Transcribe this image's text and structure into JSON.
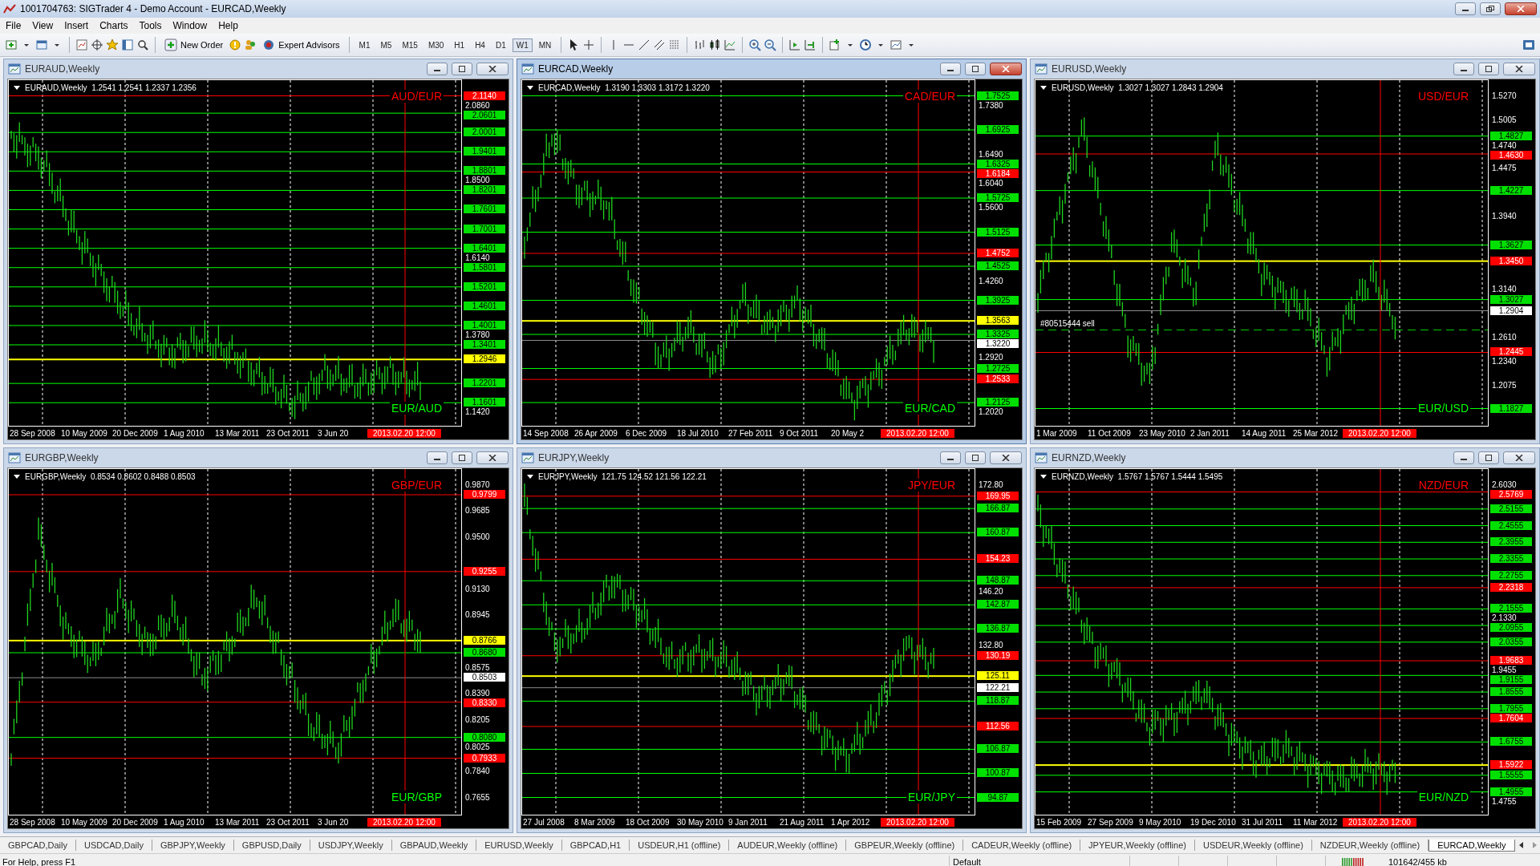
{
  "window": {
    "title": "1001704763: SIGTrader 4 - Demo Account - EURCAD,Weekly"
  },
  "menu": [
    "File",
    "View",
    "Insert",
    "Charts",
    "Tools",
    "Window",
    "Help"
  ],
  "toolbar": {
    "buttons": [
      {
        "label": "New Order"
      },
      {
        "label": "Expert Advisors"
      }
    ],
    "timeframes": [
      {
        "label": "M1",
        "selected": false
      },
      {
        "label": "M5",
        "selected": false
      },
      {
        "label": "M15",
        "selected": false
      },
      {
        "label": "M30",
        "selected": false
      },
      {
        "label": "H1",
        "selected": false
      },
      {
        "label": "H4",
        "selected": false
      },
      {
        "label": "D1",
        "selected": false
      },
      {
        "label": "W1",
        "selected": true
      },
      {
        "label": "MN",
        "selected": false
      }
    ]
  },
  "charts": [
    {
      "window_title": "EURAUD,Weekly",
      "active": false,
      "header": "EURAUD,Weekly  1.2541 1.2541 1.2337 1.2356",
      "top_label": "AUD/EUR",
      "bottom_label": "EUR/AUD",
      "axis_labels": [
        "2.0860",
        "1.8500",
        "1.6140",
        "1.3780",
        "1.1420"
      ],
      "levels": [
        {
          "price": "2.1140",
          "kind": "resistance"
        },
        {
          "price": "2.0601",
          "kind": "support"
        },
        {
          "price": "2.0001",
          "kind": "support"
        },
        {
          "price": "1.9401",
          "kind": "support"
        },
        {
          "price": "1.8801",
          "kind": "support"
        },
        {
          "price": "1.8201",
          "kind": "support"
        },
        {
          "price": "1.7601",
          "kind": "support"
        },
        {
          "price": "1.7001",
          "kind": "support"
        },
        {
          "price": "1.6401",
          "kind": "support"
        },
        {
          "price": "1.5801",
          "kind": "support"
        },
        {
          "price": "1.5201",
          "kind": "support"
        },
        {
          "price": "1.4601",
          "kind": "support"
        },
        {
          "price": "1.4001",
          "kind": "support"
        },
        {
          "price": "1.3401",
          "kind": "support"
        },
        {
          "price": "1.2946",
          "kind": "pivot"
        },
        {
          "price": "1.2201",
          "kind": "support"
        },
        {
          "price": "1.1601",
          "kind": "support"
        }
      ],
      "dates": [
        "28 Sep 2008",
        "10 May 2009",
        "20 Dec 2009",
        "1 Aug 2010",
        "13 Mar 2011",
        "23 Oct 2011",
        "3 Jun 20"
      ],
      "cursor_date": "2013.02.20 12:00"
    },
    {
      "window_title": "EURCAD,Weekly",
      "active": true,
      "header": "EURCAD,Weekly  1.3190 1.3303 1.3172 1.3220",
      "top_label": "CAD/EUR",
      "bottom_label": "EUR/CAD",
      "axis_labels": [
        "1.7380",
        "1.6490",
        "1.6040",
        "1.5600",
        "1.4260",
        "1.2920",
        "1.2020"
      ],
      "levels": [
        {
          "price": "1.7525",
          "kind": "support"
        },
        {
          "price": "1.6925",
          "kind": "support"
        },
        {
          "price": "1.6325",
          "kind": "support"
        },
        {
          "price": "1.6184",
          "kind": "resistance"
        },
        {
          "price": "1.5725",
          "kind": "support"
        },
        {
          "price": "1.5125",
          "kind": "support"
        },
        {
          "price": "1.4752",
          "kind": "resistance"
        },
        {
          "price": "1.4525",
          "kind": "support"
        },
        {
          "price": "1.3925",
          "kind": "support"
        },
        {
          "price": "1.3563",
          "kind": "pivot"
        },
        {
          "price": "1.3325",
          "kind": "support"
        },
        {
          "price": "1.3220",
          "kind": "bid"
        },
        {
          "price": "1.2725",
          "kind": "support"
        },
        {
          "price": "1.2533",
          "kind": "resistance"
        },
        {
          "price": "1.2125",
          "kind": "support"
        }
      ],
      "dates": [
        "14 Sep 2008",
        "26 Apr 2009",
        "6 Dec 2009",
        "18 Jul 2010",
        "27 Feb 2011",
        "9 Oct 2011",
        "20 May 2"
      ],
      "cursor_date": "2013.02.20 12:00"
    },
    {
      "window_title": "EURUSD,Weekly",
      "active": false,
      "header": "EURUSD,Weekly  1.3027 1.3027 1.2843 1.2904",
      "top_label": "USD/EUR",
      "bottom_label": "EUR/USD",
      "axis_labels": [
        "1.5270",
        "1.5005",
        "1.4740",
        "1.4475",
        "1.3940",
        "1.3140",
        "1.2610",
        "1.2340",
        "1.2075"
      ],
      "levels": [
        {
          "price": "1.4827",
          "kind": "support"
        },
        {
          "price": "1.4630",
          "kind": "resistance"
        },
        {
          "price": "1.4227",
          "kind": "support"
        },
        {
          "price": "1.3627",
          "kind": "support"
        },
        {
          "price": "1.3450",
          "kind": "alert"
        },
        {
          "price": "1.3027",
          "kind": "support"
        },
        {
          "price": "1.2904",
          "kind": "bid"
        },
        {
          "price": "1.2445",
          "kind": "resistance"
        },
        {
          "price": "1.1827",
          "kind": "support"
        }
      ],
      "order_line": {
        "label": "#80515444 sell"
      },
      "dates": [
        "1 Mar 2009",
        "11 Oct 2009",
        "23 May 2010",
        "2 Jan 2011",
        "14 Aug 2011",
        "25 Mar 2012"
      ],
      "cursor_date": "2013.02.20 12:00"
    },
    {
      "window_title": "EURGBP,Weekly",
      "active": false,
      "header": "EURGBP,Weekly  0.8534 0.8602 0.8488 0.8503",
      "top_label": "GBP/EUR",
      "bottom_label": "EUR/GBP",
      "axis_labels": [
        "0.9870",
        "0.9685",
        "0.9500",
        "0.9130",
        "0.8945",
        "0.8575",
        "0.8390",
        "0.8205",
        "0.8025",
        "0.7840",
        "0.7655"
      ],
      "levels": [
        {
          "price": "0.9799",
          "kind": "resistance"
        },
        {
          "price": "0.9255",
          "kind": "resistance"
        },
        {
          "price": "0.8766",
          "kind": "pivot"
        },
        {
          "price": "0.8680",
          "kind": "support"
        },
        {
          "price": "0.8503",
          "kind": "bid"
        },
        {
          "price": "0.8330",
          "kind": "resistance"
        },
        {
          "price": "0.8080",
          "kind": "support"
        },
        {
          "price": "0.7933",
          "kind": "resistance"
        }
      ],
      "dates": [
        "28 Sep 2008",
        "10 May 2009",
        "20 Dec 2009",
        "1 Aug 2010",
        "13 Mar 2011",
        "23 Oct 2011",
        "3 Jun 20"
      ],
      "cursor_date": "2013.02.20 12:00"
    },
    {
      "window_title": "EURJPY,Weekly",
      "active": false,
      "header": "EURJPY,Weekly  121.75 124.52 121.56 122.21",
      "top_label": "JPY/EUR",
      "bottom_label": "EUR/JPY",
      "axis_labels": [
        "172.80",
        "146.20",
        "132.80"
      ],
      "levels": [
        {
          "price": "169.95",
          "kind": "resistance"
        },
        {
          "price": "166.87",
          "kind": "support"
        },
        {
          "price": "160.87",
          "kind": "support"
        },
        {
          "price": "154.23",
          "kind": "resistance"
        },
        {
          "price": "148.87",
          "kind": "support"
        },
        {
          "price": "142.87",
          "kind": "support"
        },
        {
          "price": "136.87",
          "kind": "support"
        },
        {
          "price": "130.19",
          "kind": "resistance"
        },
        {
          "price": "125.11",
          "kind": "pivot"
        },
        {
          "price": "122.21",
          "kind": "bid"
        },
        {
          "price": "118.87",
          "kind": "support"
        },
        {
          "price": "112.56",
          "kind": "resistance"
        },
        {
          "price": "106.87",
          "kind": "support"
        },
        {
          "price": "100.87",
          "kind": "support"
        },
        {
          "price": "94.87",
          "kind": "support"
        }
      ],
      "dates": [
        "27 Jul 2008",
        "8 Mar 2009",
        "18 Oct 2009",
        "30 May 2010",
        "9 Jan 2011",
        "21 Aug 2011",
        "1 Apr 2012"
      ],
      "cursor_date": "2013.02.20 12:00"
    },
    {
      "window_title": "EURNZD,Weekly",
      "active": false,
      "header": "EURNZD,Weekly  1.5767 1.5767 1.5444 1.5495",
      "top_label": "NZD/EUR",
      "bottom_label": "EUR/NZD",
      "axis_labels": [
        "2.6030",
        "2.1330",
        "1.9455",
        "1.4755"
      ],
      "levels": [
        {
          "price": "2.5769",
          "kind": "resistance"
        },
        {
          "price": "2.5155",
          "kind": "support"
        },
        {
          "price": "2.4555",
          "kind": "support"
        },
        {
          "price": "2.3955",
          "kind": "support"
        },
        {
          "price": "2.3355",
          "kind": "support"
        },
        {
          "price": "2.2755",
          "kind": "support"
        },
        {
          "price": "2.2318",
          "kind": "resistance"
        },
        {
          "price": "2.1555",
          "kind": "support"
        },
        {
          "price": "2.0955",
          "kind": "support"
        },
        {
          "price": "2.0355",
          "kind": "support"
        },
        {
          "price": "1.9683",
          "kind": "resistance"
        },
        {
          "price": "1.9155",
          "kind": "support"
        },
        {
          "price": "1.8555",
          "kind": "support"
        },
        {
          "price": "1.7955",
          "kind": "support"
        },
        {
          "price": "1.7604",
          "kind": "resistance"
        },
        {
          "price": "1.6755",
          "kind": "support"
        },
        {
          "price": "1.5922",
          "kind": "alert"
        },
        {
          "price": "1.5555",
          "kind": "support"
        },
        {
          "price": "1.4955",
          "kind": "support"
        }
      ],
      "dates": [
        "15 Feb 2009",
        "27 Sep 2009",
        "9 May 2010",
        "19 Dec 2010",
        "31 Jul 2011",
        "11 Mar 2012"
      ],
      "cursor_date": "2013.02.20 12:00"
    }
  ],
  "tabs": [
    {
      "label": "GBPCAD,Daily",
      "selected": false
    },
    {
      "label": "USDCAD,Daily",
      "selected": false
    },
    {
      "label": "GBPJPY,Weekly",
      "selected": false
    },
    {
      "label": "GBPUSD,Daily",
      "selected": false
    },
    {
      "label": "USDJPY,Weekly",
      "selected": false
    },
    {
      "label": "GBPAUD,Weekly",
      "selected": false
    },
    {
      "label": "EURUSD,Weekly",
      "selected": false
    },
    {
      "label": "GBPCAD,H1",
      "selected": false
    },
    {
      "label": "USDEUR,H1 (offline)",
      "selected": false
    },
    {
      "label": "AUDEUR,Weekly (offline)",
      "selected": false
    },
    {
      "label": "GBPEUR,Weekly (offline)",
      "selected": false
    },
    {
      "label": "CADEUR,Weekly (offline)",
      "selected": false
    },
    {
      "label": "JPYEUR,Weekly (offline)",
      "selected": false
    },
    {
      "label": "USDEUR,Weekly (offline)",
      "selected": false
    },
    {
      "label": "NZDEUR,Weekly (offline)",
      "selected": false
    },
    {
      "label": "EURCAD,Weekly",
      "selected": true
    }
  ],
  "status_bar": {
    "help": "For Help, press F1",
    "profile": "Default",
    "traffic": "101642/455 kb"
  }
}
